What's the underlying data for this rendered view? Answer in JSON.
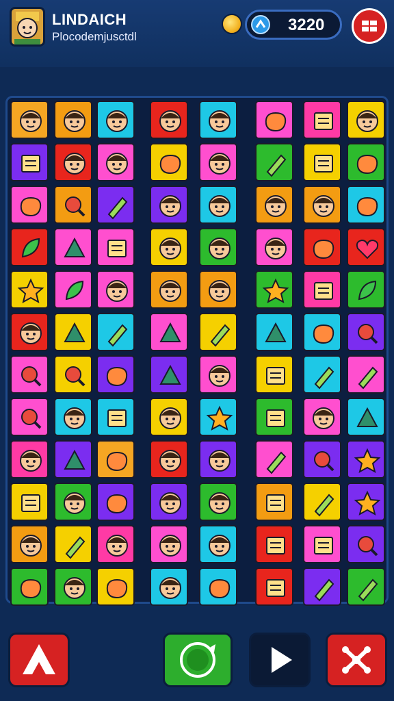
{
  "header": {
    "title": "LINDAICH",
    "subtitle": "Plocodemjusctdl",
    "score": "3220",
    "avatar_icon": "avatar-face-icon",
    "coin_icon": "coin-icon",
    "score_icon": "score-badge-icon",
    "settings_icon": "settings-icon"
  },
  "board": {
    "rows": 12,
    "cols": 9,
    "tiles": [
      [
        "#f5a623:face",
        "#f39c12:face",
        "#1ec8e6:face",
        "#e8251d:face",
        "#1ec8e6:face",
        "#ff4fcf:blob",
        "#ff3aa5:box",
        "#f5d000:face"
      ],
      [
        "#7b2df0:box",
        "#e8251d:face",
        "#ff4fcf:face",
        "#f5d000:blob",
        "#ff4fcf:face",
        "#2dbb2d:stick",
        "#f5d000:box",
        "#2dbb2d:blob"
      ],
      [
        "#ff4fcf:blob",
        "#f39c12:ring",
        "#7b2df0:stick",
        "#7b2df0:face",
        "#1ec8e6:face",
        "#f39c12:face",
        "#f39c12:face",
        "#1ec8e6:blob"
      ],
      [
        "#e8251d:leaf",
        "#ff4fcf:tri",
        "#ff4fcf:box",
        "#f5d000:face",
        "#2dbb2d:face",
        "#ff4fcf:face",
        "#e8251d:blob",
        "#e8251d:heart"
      ],
      [
        "#f5d000:star",
        "#ff4fcf:leaf",
        "#ff4fcf:face",
        "#f39c12:face",
        "#f39c12:face",
        "#2dbb2d:star",
        "#ff3aa5:box",
        "#2dbb2d:leaf"
      ],
      [
        "#e8251d:face",
        "#f5d000:tri",
        "#1ec8e6:stick",
        "#ff4fcf:tri",
        "#f5d000:stick",
        "#1ec8e6:tri",
        "#1ec8e6:blob",
        "#7b2df0:ring"
      ],
      [
        "#ff4fcf:ring",
        "#f5d000:ring",
        "#7b2df0:blob",
        "#7b2df0:tri",
        "#ff4fcf:face",
        "#f5d000:box",
        "#1ec8e6:stick",
        "#ff4fcf:stick"
      ],
      [
        "#ff4fcf:ring",
        "#1ec8e6:face",
        "#1ec8e6:box",
        "#f5d000:face",
        "#1ec8e6:star",
        "#2dbb2d:box",
        "#ff4fcf:face",
        "#1ec8e6:tri"
      ],
      [
        "#ff3aa5:face",
        "#7b2df0:tri",
        "#f5a623:blob",
        "#e8251d:face",
        "#7b2df0:face",
        "#ff4fcf:stick",
        "#7b2df0:ring",
        "#7b2df0:star"
      ],
      [
        "#f5d000:box",
        "#2dbb2d:face",
        "#7b2df0:blob",
        "#7b2df0:face",
        "#2dbb2d:face",
        "#f39c12:box",
        "#f5d000:stick",
        "#7b2df0:star"
      ],
      [
        "#f39c12:face",
        "#f5d000:stick",
        "#ff3aa5:face",
        "#ff4fcf:face",
        "#1ec8e6:face",
        "#e8251d:box",
        "#ff4fcf:box",
        "#7b2df0:ring"
      ],
      [
        "#2dbb2d:blob",
        "#2dbb2d:face",
        "#f5d000:blob",
        "#1ec8e6:face",
        "#1ec8e6:blob",
        "#e8251d:box",
        "#7b2df0:stick",
        "#2dbb2d:stick"
      ]
    ]
  },
  "controls": {
    "left_icon": "warning-triangle-icon",
    "left_color": "#d62222",
    "center_icon": "refresh-icon",
    "center_color": "#2dae2d",
    "play_icon": "play-icon",
    "play_color": "#0b1a35",
    "right_icon": "shuffle-icon",
    "right_color": "#d62222"
  }
}
